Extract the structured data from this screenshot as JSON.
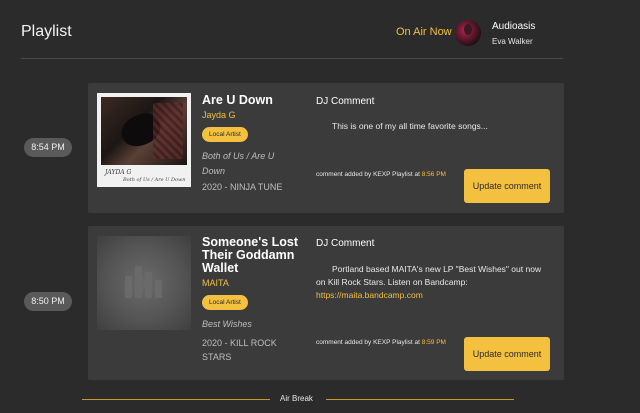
{
  "header": {
    "title": "Playlist",
    "on_air_label": "On Air Now",
    "show_name": "Audioasis",
    "host_name": "Eva Walker"
  },
  "tracks": [
    {
      "time": "8:54 PM",
      "title": "Are U Down",
      "artist": "Jayda G",
      "badge": "Local Artist",
      "album": "Both of Us / Are U Down",
      "release": "2020 - NINJA TUNE",
      "art_text": "JAYDA G",
      "art_subtext": "Both of Us / Are U Down",
      "comment_heading": "DJ Comment",
      "comment": "This is one of my all time favorite songs...",
      "comment_link": "",
      "added_prefix": "comment added by KEXP Playlist at",
      "added_time": "8:56 PM",
      "button": "Update comment"
    },
    {
      "time": "8:50 PM",
      "title": "Someone's Lost Their Goddamn Wallet",
      "artist": "MAITA",
      "badge": "Local Artist",
      "album": "Best Wishes",
      "release": "2020 - KILL ROCK STARS",
      "comment_heading": "DJ Comment",
      "comment": "Portland based MAITA's new LP \"Best Wishes\" out now on Kill Rock Stars. Listen on Bandcamp:",
      "comment_link": "https://maita.bandcamp.com",
      "added_prefix": "comment added by KEXP Playlist at",
      "added_time": "8:59 PM",
      "button": "Update comment"
    }
  ],
  "air_break": "Air Break",
  "colors": {
    "background": "#2b2b2b",
    "card": "#3b3b3b",
    "accent": "#f3c03f",
    "pill": "#5a5a5a"
  }
}
